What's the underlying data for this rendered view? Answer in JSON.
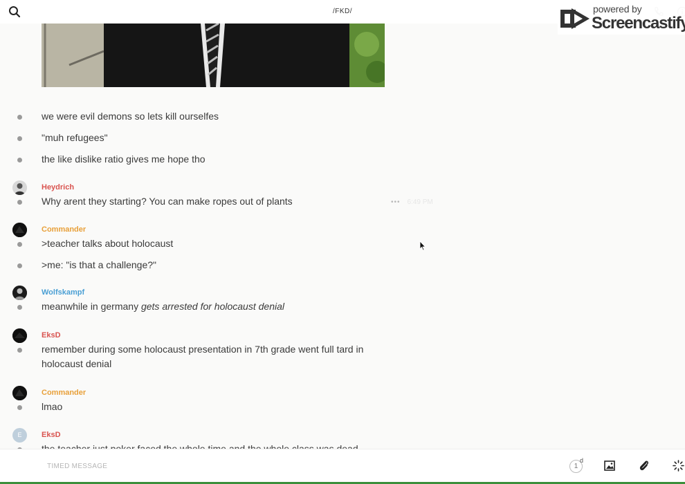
{
  "header": {
    "title": "/FKD/",
    "search_icon": "search-icon",
    "phone_icon": "phone-icon",
    "info_icon": "info-icon"
  },
  "watermark": {
    "line1": "powered by",
    "line2": "Screencastify"
  },
  "messages": [
    {
      "text": "we were evil demons so lets kill ourselfes"
    },
    {
      "text": "\"muh refugees\""
    },
    {
      "text": "the like dislike ratio gives me hope tho"
    },
    {
      "author": "Heydrich",
      "color": "#d9534f",
      "text": "Why arent they starting? You can make ropes out of plants",
      "time": "6:49 PM"
    },
    {
      "author": "Commander",
      "color": "#e8a03a",
      "text": ">teacher talks about holocaust"
    },
    {
      "text": ">me: \"is that a challenge?\""
    },
    {
      "author": "Wolfskampf",
      "color": "#4a9fd4",
      "text": "meanwhile in germany ",
      "text_em": "gets arrested for holocaust denial"
    },
    {
      "author": "EksD",
      "color": "#d9534f",
      "text": "remember during some holocaust presentation in 7th grade went full tard in holocaust denial"
    },
    {
      "author": "Commander",
      "color": "#e8a03a",
      "text": "lmao"
    },
    {
      "author": "EksD",
      "color": "#d9534f",
      "avatar_letter": "E",
      "text": "the teacher just poker faced the whole time and the whole class was dead"
    }
  ],
  "composer": {
    "placeholder": "TIMED MESSAGE",
    "timer_value": "1",
    "timer_unit": "d",
    "image_icon": "image-icon",
    "attach_icon": "paperclip-icon",
    "loading_icon": "spinner-icon"
  }
}
